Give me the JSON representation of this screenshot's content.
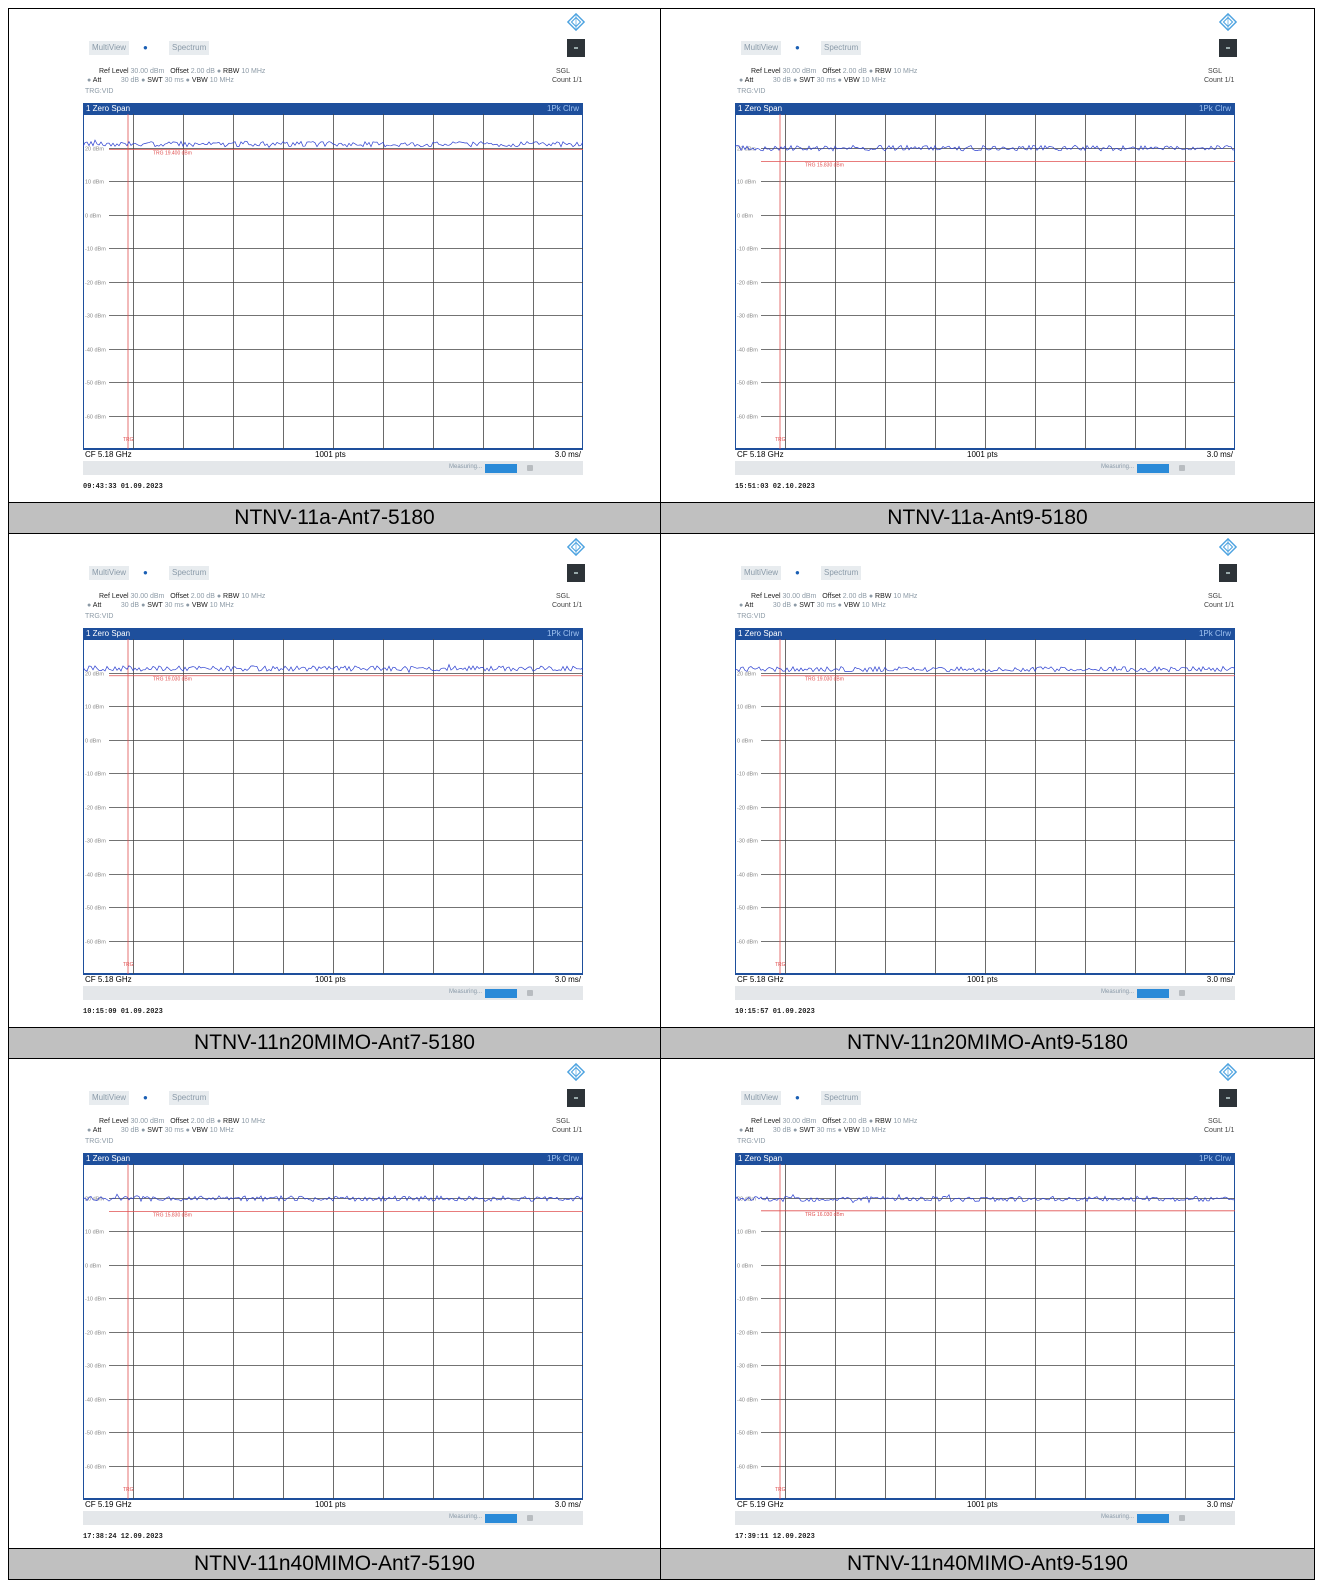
{
  "panels": [
    {
      "caption": "NTNV-11a-Ant7-5180",
      "timestamp": "09:43:33  01.09.2023",
      "cf": "CF 5.18 GHz",
      "trigger": "TRG 19.400 dBm",
      "trace_level": 21.0,
      "trig_level": 19.4
    },
    {
      "caption": "NTNV-11a-Ant9-5180",
      "timestamp": "15:51:03  02.10.2023",
      "cf": "CF 5.18 GHz",
      "trigger": "TRG 15.830 dBm",
      "trace_level": 19.8,
      "trig_level": 15.83
    },
    {
      "caption": "NTNV-11n20MIMO-Ant7-5180",
      "timestamp": "10:15:09  01.09.2023",
      "cf": "CF 5.18 GHz",
      "trigger": "TRG 19.030 dBm",
      "trace_level": 21.2,
      "trig_level": 19.03
    },
    {
      "caption": "NTNV-11n20MIMO-Ant9-5180",
      "timestamp": "10:15:57  01.09.2023",
      "cf": "CF 5.18 GHz",
      "trigger": "TRG 19.030 dBm",
      "trace_level": 21.0,
      "trig_level": 19.03
    },
    {
      "caption": "NTNV-11n40MIMO-Ant7-5190",
      "timestamp": "17:38:24  12.09.2023",
      "cf": "CF 5.19 GHz",
      "trigger": "TRG 15.830 dBm",
      "trace_level": 19.7,
      "trig_level": 15.83
    },
    {
      "caption": "NTNV-11n40MIMO-Ant9-5190",
      "timestamp": "17:39:11  12.09.2023",
      "cf": "CF 5.19 GHz",
      "trigger": "TRG 16.030 dBm",
      "trace_level": 19.6,
      "trig_level": 16.03
    }
  ],
  "common": {
    "tab1": "MultiView",
    "tab2": "Spectrum",
    "ref_level_label": "Ref Level",
    "ref_level": "30.00 dBm",
    "offset_label": "Offset",
    "offset": "2.00 dB",
    "rbw_label": "RBW",
    "rbw": "10 MHz",
    "att_label": "Att",
    "att": "30 dB",
    "swt_label": "SWT",
    "swt": "30 ms",
    "vbw_label": "VBW",
    "vbw": "10 MHz",
    "trg": "TRG:VID",
    "sgl": "SGL",
    "count": "Count 1/1",
    "window": "1 Zero Span",
    "trace_mode": "1Pk Clrw",
    "points": "1001 pts",
    "time_div": "3.0 ms/",
    "measuring": "Measuring...",
    "trg_marker": "TRG"
  },
  "chart_data": {
    "type": "line",
    "title": "",
    "xlabel": "",
    "ylabel": "",
    "y_ticks": [
      "20 dBm",
      "10 dBm",
      "0 dBm",
      "-10 dBm",
      "-20 dBm",
      "-30 dBm",
      "-40 dBm",
      "-50 dBm",
      "-60 dBm"
    ],
    "y_values": [
      20,
      10,
      0,
      -10,
      -20,
      -30,
      -40,
      -50,
      -60
    ],
    "ylim": [
      -70,
      30
    ],
    "x_divisions": 10,
    "x_total_ms": 30,
    "grid": true,
    "series": [
      {
        "panel": "NTNV-11a-Ant7-5180",
        "mean_dbm": 21.0,
        "trigger_dbm": 19.4
      },
      {
        "panel": "NTNV-11a-Ant9-5180",
        "mean_dbm": 19.8,
        "trigger_dbm": 15.83
      },
      {
        "panel": "NTNV-11n20MIMO-Ant7-5180",
        "mean_dbm": 21.2,
        "trigger_dbm": 19.03
      },
      {
        "panel": "NTNV-11n20MIMO-Ant9-5180",
        "mean_dbm": 21.0,
        "trigger_dbm": 19.03
      },
      {
        "panel": "NTNV-11n40MIMO-Ant7-5190",
        "mean_dbm": 19.7,
        "trigger_dbm": 15.83
      },
      {
        "panel": "NTNV-11n40MIMO-Ant9-5190",
        "mean_dbm": 19.6,
        "trigger_dbm": 16.03
      }
    ]
  }
}
